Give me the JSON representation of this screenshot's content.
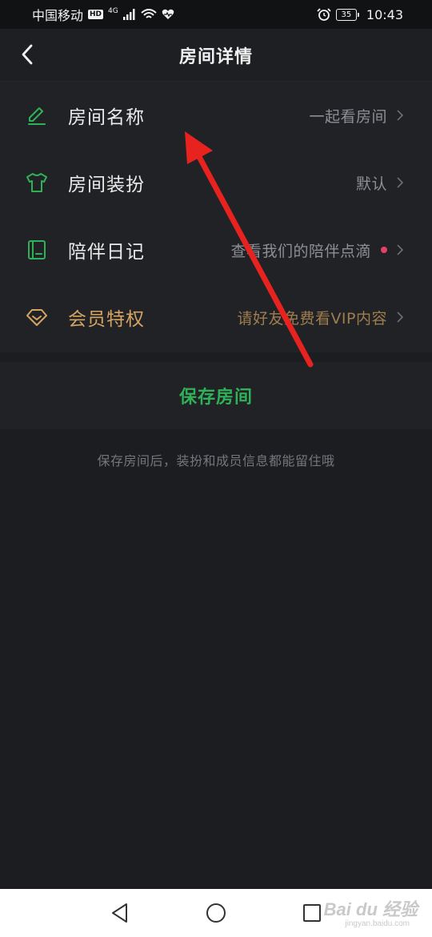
{
  "status_bar": {
    "carrier": "中国移动",
    "hd": "HD",
    "network": "4G",
    "battery": "35",
    "time": "10:43"
  },
  "header": {
    "title": "房间详情"
  },
  "items": [
    {
      "label": "房间名称",
      "value": "一起看房间",
      "icon": "pencil-icon"
    },
    {
      "label": "房间装扮",
      "value": "默认",
      "icon": "tshirt-icon"
    },
    {
      "label": "陪伴日记",
      "value": "查看我们的陪伴点滴",
      "icon": "diary-icon",
      "has_dot": true
    },
    {
      "label": "会员特权",
      "value": "请好友免费看VIP内容",
      "icon": "diamond-icon"
    }
  ],
  "save": {
    "label": "保存房间"
  },
  "hint": "保存房间后，装扮和成员信息都能留住哦",
  "watermark": {
    "brand": "Bai du 经验",
    "sub": "jingyan.baidu.com"
  },
  "colors": {
    "accent_green": "#2fb158",
    "vip_gold": "#d5a463",
    "dot_red": "#e64067",
    "arrow_red": "#e8221f"
  }
}
